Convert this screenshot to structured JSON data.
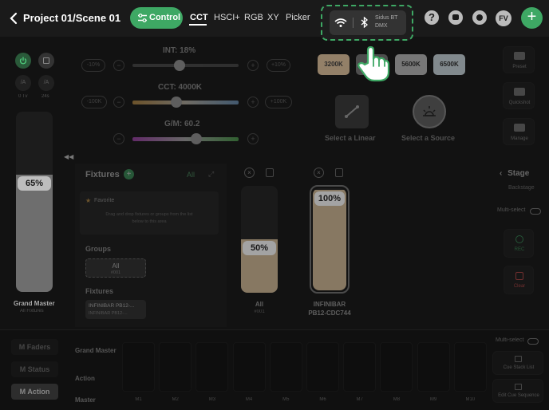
{
  "header": {
    "back_icon": "chevron-left-icon",
    "title": "Project 01/Scene 01",
    "control_label": "Control",
    "tabs": [
      "CCT",
      "HSCI+",
      "RGB",
      "XY",
      "Picker"
    ],
    "connection": {
      "bt_name": "Sidus BT",
      "dmx": "DMX"
    },
    "avatar": "FV"
  },
  "sliders": {
    "int": {
      "label": "INT: 18%",
      "min": "-10%",
      "max": "+10%",
      "value": 0.44
    },
    "cct": {
      "label": "CCT: 4000K",
      "min": "-100K",
      "max": "+100K",
      "value": 0.41
    },
    "gm": {
      "label": "G/M: 60.2",
      "value": 0.6
    }
  },
  "presets": [
    "3200K",
    "5600K",
    "6500K"
  ],
  "selectors": {
    "linear": "Select a Linear",
    "source": "Select a Source"
  },
  "right_panel": {
    "preset": "Preset",
    "quickshot": "Quickshot",
    "manage": "Manage"
  },
  "grand_master": {
    "percent": "65%",
    "value": 0.65,
    "label": "Grand Master",
    "sub": "All Fixtures",
    "tv": "0 Tv",
    "bv": "24s"
  },
  "fixtures_panel": {
    "title": "Fixtures",
    "all": "All",
    "favorite": "Favorite",
    "favorite_hint_1": "Drag and drop fixtures or groups from the list",
    "favorite_hint_2": "below to this area",
    "groups_title": "Groups",
    "group_item": {
      "name": "All",
      "sub": "#001"
    },
    "fixtures_title": "Fixtures",
    "fixture_item": {
      "name": "INFINIBAR PB12-...",
      "sub": "INFINIBAR PB12-..."
    }
  },
  "faders": [
    {
      "percent": "50%",
      "value": 0.5,
      "name": "All",
      "sub": "#001"
    },
    {
      "percent": "100%",
      "value": 1.0,
      "name": "INFINIBAR",
      "sub": "PB12-CDC744"
    }
  ],
  "stage": {
    "title": "Stage",
    "sub": "Backstage",
    "multiselect": "Multi-select",
    "rec": "REC",
    "clear": "Clear"
  },
  "bottom": {
    "tabs": [
      "M Faders",
      "M Status",
      "M Action"
    ],
    "row_labels": [
      "Grand Master",
      "Action",
      "Master"
    ],
    "slots": [
      "M1",
      "M2",
      "M3",
      "M4",
      "M5",
      "M6",
      "M7",
      "M8",
      "M9",
      "M10"
    ],
    "multiselect": "Multi-select",
    "cue_stack": "Cue Stack List",
    "edit_cue": "Edit Cue Sequence"
  },
  "colors": {
    "accent": "#3ea864",
    "tan": "#d2b890"
  }
}
